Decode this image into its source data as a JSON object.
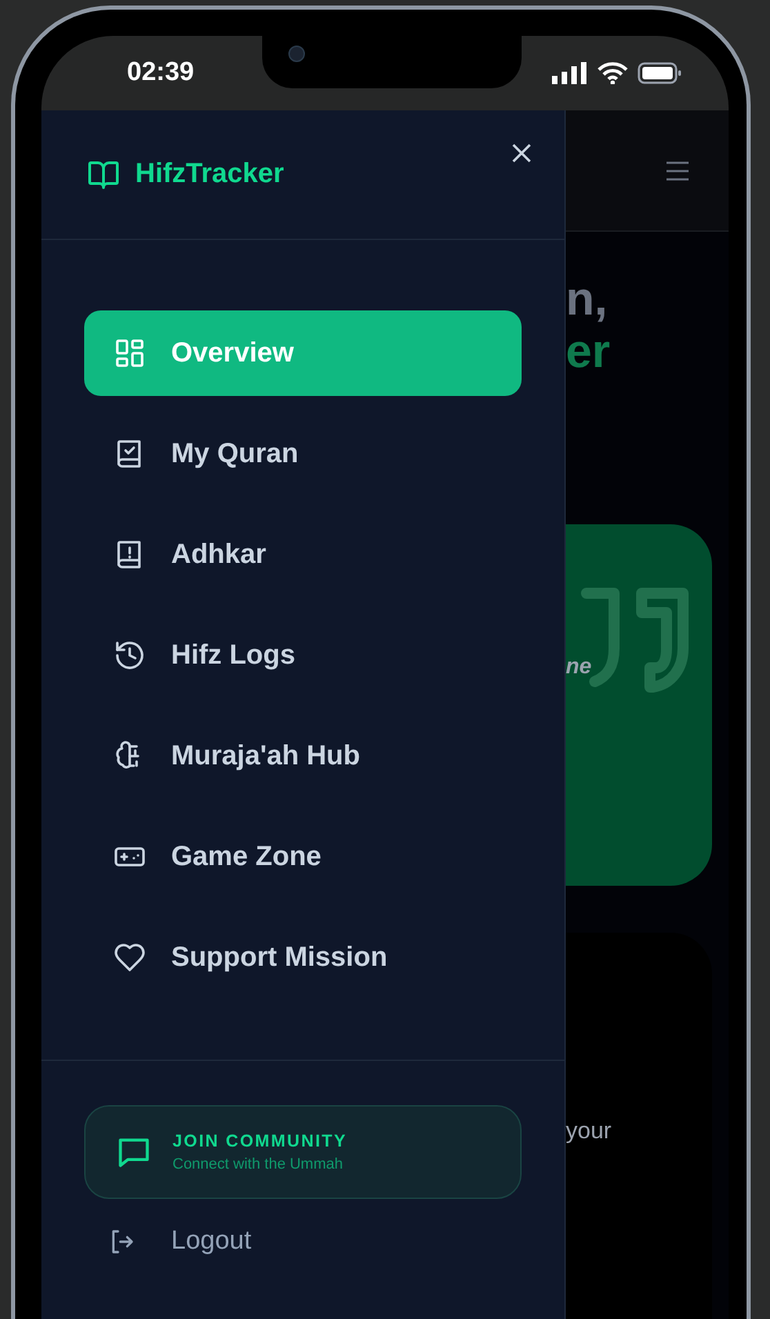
{
  "status_bar": {
    "time": "02:39"
  },
  "drawer": {
    "brand": "HifzTracker",
    "nav": [
      {
        "label": "Overview",
        "selected": true,
        "kind": "grid"
      },
      {
        "label": "My Quran",
        "selected": false,
        "kind": "book-check"
      },
      {
        "label": "Adhkar",
        "selected": false,
        "kind": "book-alert"
      },
      {
        "label": "Hifz Logs",
        "selected": false,
        "kind": "history"
      },
      {
        "label": "Muraja'ah Hub",
        "selected": false,
        "kind": "brain"
      },
      {
        "label": "Game Zone",
        "selected": false,
        "kind": "gamepad"
      },
      {
        "label": "Support Mission",
        "selected": false,
        "kind": "heart"
      }
    ],
    "community": {
      "title": "JOIN COMMUNITY",
      "subtitle": "Connect with the Ummah"
    },
    "logout": "Logout"
  },
  "background": {
    "heading_line_1": "n,",
    "heading_line_2": "er",
    "card_text": "ne",
    "body_text": "your"
  }
}
